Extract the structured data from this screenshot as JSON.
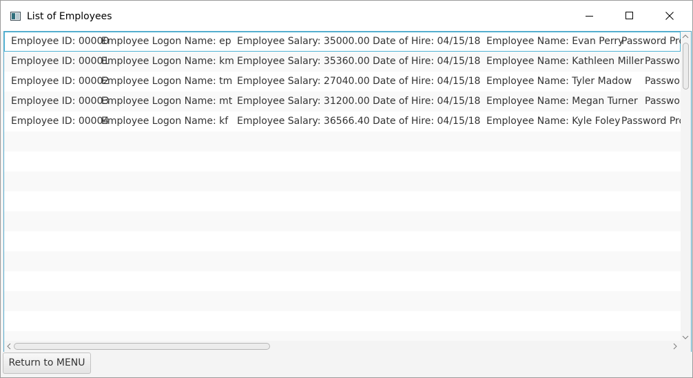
{
  "window": {
    "title": "List of Employees",
    "controls": {
      "minimize_icon": "minimize-icon",
      "maximize_icon": "maximize-icon",
      "close_icon": "close-icon"
    }
  },
  "employees": [
    {
      "id": "Employee ID: 00000",
      "logon": "Employee Logon Name: ep",
      "salary": "Employee Salary: 35000.00",
      "hire": "Date of Hire: 04/15/18",
      "name": "Employee Name: Evan Perry",
      "password": "Password Pro"
    },
    {
      "id": "Employee ID: 00001",
      "logon": "Employee Logon Name: km",
      "salary": "Employee Salary: 35360.00",
      "hire": "Date of Hire: 04/15/18",
      "name": "Employee Name: Kathleen Miller",
      "password": "Passwor"
    },
    {
      "id": "Employee ID: 00002",
      "logon": "Employee Logon Name: tm",
      "salary": "Employee Salary: 27040.00",
      "hire": "Date of Hire: 04/15/18",
      "name": "Employee Name: Tyler Madow",
      "password": "Passwor"
    },
    {
      "id": "Employee ID: 00003",
      "logon": "Employee Logon Name: mt",
      "salary": "Employee Salary: 31200.00",
      "hire": "Date of Hire: 04/15/18",
      "name": "Employee Name: Megan Turner",
      "password": "Passwor"
    },
    {
      "id": "Employee ID: 00004",
      "logon": "Employee Logon Name: kf",
      "salary": "Employee Salary: 36566.40",
      "hire": "Date of Hire: 04/15/18",
      "name": "Employee Name: Kyle Foley",
      "password": "Password Pro"
    }
  ],
  "footer": {
    "return_button": "Return to MENU"
  },
  "colors": {
    "selection_border": "#4fb3d4",
    "list_border": "#55a8c8",
    "stripe": "#f9f9f9"
  }
}
